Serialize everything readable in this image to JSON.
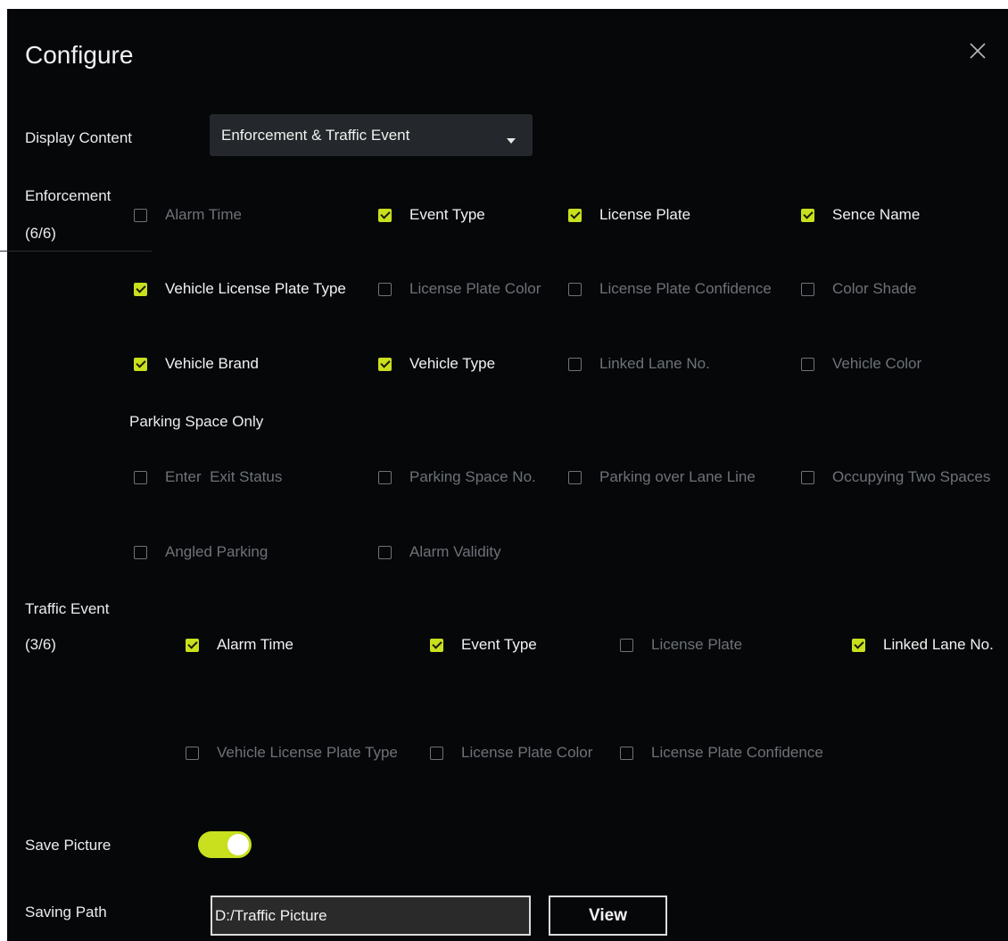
{
  "dialog": {
    "title": "Configure"
  },
  "display_content": {
    "label": "Display Content",
    "value": "Enforcement & Traffic Event"
  },
  "enforcement": {
    "label": "Enforcement",
    "count": "(6/6)",
    "items": [
      {
        "label": "Alarm Time",
        "checked": false
      },
      {
        "label": "Event Type",
        "checked": true
      },
      {
        "label": "License Plate",
        "checked": true
      },
      {
        "label": "Sence Name",
        "checked": true
      },
      {
        "label": "Vehicle License Plate Type",
        "checked": true
      },
      {
        "label": "License Plate Color",
        "checked": false
      },
      {
        "label": "License Plate Confidence",
        "checked": false
      },
      {
        "label": "Color Shade",
        "checked": false
      },
      {
        "label": "Vehicle Brand",
        "checked": true
      },
      {
        "label": "Vehicle Type",
        "checked": true
      },
      {
        "label": "Linked Lane No.",
        "checked": false
      },
      {
        "label": "Vehicle Color",
        "checked": false
      }
    ],
    "parking_label": "Parking Space Only",
    "parking_items": [
      {
        "label": "Enter  Exit Status",
        "checked": false
      },
      {
        "label": "Parking Space No.",
        "checked": false
      },
      {
        "label": "Parking over Lane Line",
        "checked": false
      },
      {
        "label": "Occupying Two Spaces",
        "checked": false
      },
      {
        "label": "Angled Parking",
        "checked": false
      },
      {
        "label": "Alarm Validity",
        "checked": false
      }
    ]
  },
  "traffic": {
    "label": "Traffic Event",
    "count": "(3/6)",
    "items": [
      {
        "label": "Alarm Time",
        "checked": true
      },
      {
        "label": "Event Type",
        "checked": true
      },
      {
        "label": "License Plate",
        "checked": false
      },
      {
        "label": "Linked Lane No.",
        "checked": true
      },
      {
        "label": "Vehicle License Plate Type",
        "checked": false
      },
      {
        "label": "License Plate Color",
        "checked": false
      },
      {
        "label": "License Plate Confidence",
        "checked": false
      }
    ]
  },
  "save_picture": {
    "label": "Save Picture",
    "enabled": true
  },
  "saving_path": {
    "label": "Saving Path",
    "value": "D:/Traffic Picture",
    "button": "View"
  },
  "colors": {
    "accent": "#c8e01e",
    "background": "#050709",
    "dropdown": "#24272b"
  }
}
